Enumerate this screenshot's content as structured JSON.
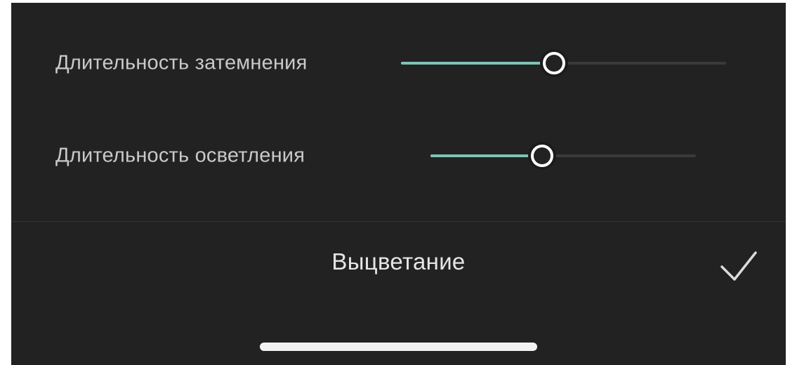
{
  "colors": {
    "background": "#222222",
    "accent": "#7fc3b6",
    "track": "#3a3a3a",
    "text": "#c9c9c9",
    "title": "#e6e6e6"
  },
  "sliders": [
    {
      "label": "Длительность затемнения",
      "value": 0.47
    },
    {
      "label": "Длительность осветления",
      "value": 0.42
    }
  ],
  "bottom_bar": {
    "title": "Выцветание",
    "confirm_icon": "checkmark-icon"
  }
}
